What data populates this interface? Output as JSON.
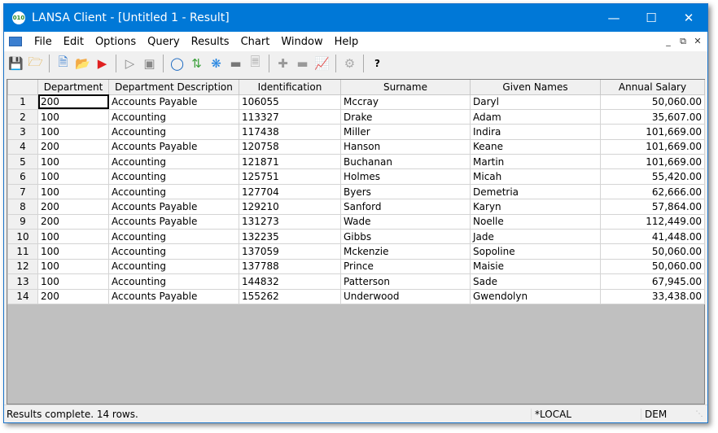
{
  "window": {
    "title": "LANSA Client - [Untitled 1 - Result]",
    "logo": "010"
  },
  "menu": [
    "File",
    "Edit",
    "Options",
    "Query",
    "Results",
    "Chart",
    "Window",
    "Help"
  ],
  "toolbar": {
    "help_label": "?"
  },
  "table": {
    "headers": [
      "Department",
      "Department Description",
      "Identification",
      "Surname",
      "Given Names",
      "Annual Salary"
    ],
    "rows": [
      [
        "200",
        "Accounts Payable",
        "106055",
        "Mccray",
        "Daryl",
        "50,060.00"
      ],
      [
        "100",
        "Accounting",
        "113327",
        "Drake",
        "Adam",
        "35,607.00"
      ],
      [
        "100",
        "Accounting",
        "117438",
        "Miller",
        "Indira",
        "101,669.00"
      ],
      [
        "200",
        "Accounts Payable",
        "120758",
        "Hanson",
        "Keane",
        "101,669.00"
      ],
      [
        "100",
        "Accounting",
        "121871",
        "Buchanan",
        "Martin",
        "101,669.00"
      ],
      [
        "100",
        "Accounting",
        "125751",
        "Holmes",
        "Micah",
        "55,420.00"
      ],
      [
        "100",
        "Accounting",
        "127704",
        "Byers",
        "Demetria",
        "62,666.00"
      ],
      [
        "200",
        "Accounts Payable",
        "129210",
        "Sanford",
        "Karyn",
        "57,864.00"
      ],
      [
        "200",
        "Accounts Payable",
        "131273",
        "Wade",
        "Noelle",
        "112,449.00"
      ],
      [
        "100",
        "Accounting",
        "132235",
        "Gibbs",
        "Jade",
        "41,448.00"
      ],
      [
        "100",
        "Accounting",
        "137059",
        "Mckenzie",
        "Sopoline",
        "50,060.00"
      ],
      [
        "100",
        "Accounting",
        "137788",
        "Prince",
        "Maisie",
        "50,060.00"
      ],
      [
        "100",
        "Accounting",
        "144832",
        "Patterson",
        "Sade",
        "67,945.00"
      ],
      [
        "200",
        "Accounts Payable",
        "155262",
        "Underwood",
        "Gwendolyn",
        "33,438.00"
      ]
    ]
  },
  "status": {
    "message": "Results complete. 14 rows.",
    "server": "*LOCAL",
    "partition": "DEM"
  }
}
